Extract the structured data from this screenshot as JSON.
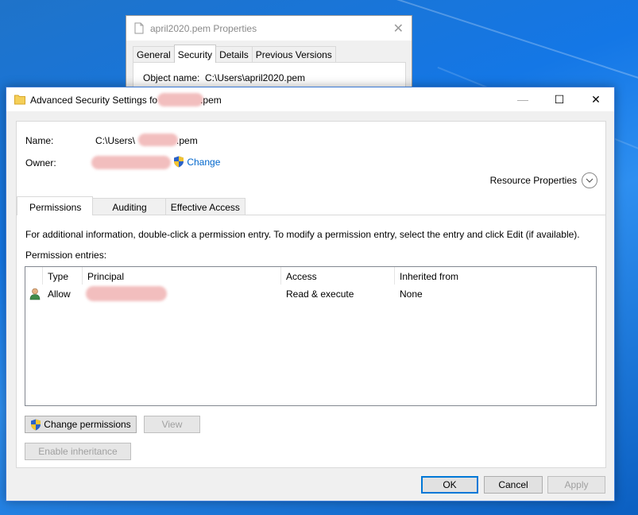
{
  "properties_dialog": {
    "title": "april2020.pem Properties",
    "tabs": [
      "General",
      "Security",
      "Details",
      "Previous Versions"
    ],
    "object_name_label": "Object name:",
    "object_name_value": "C:\\Users\\april2020.pem"
  },
  "window": {
    "title_prefix": "Advanced Security Settings fo",
    "title_suffix": ".pem",
    "minimize": "—",
    "maximize": "☐",
    "close": "✕"
  },
  "info": {
    "name_label": "Name:",
    "name_prefix": "C:\\Users\\",
    "name_suffix": ".pem",
    "owner_label": "Owner:",
    "change_link": "Change",
    "resource_properties": "Resource Properties"
  },
  "tabs": [
    "Permissions",
    "Auditing",
    "Effective Access"
  ],
  "permissions": {
    "help_text": "For additional information, double-click a permission entry. To modify a permission entry, select the entry and click Edit (if available).",
    "entries_label": "Permission entries:",
    "columns": [
      "Type",
      "Principal",
      "Access",
      "Inherited from"
    ],
    "rows": [
      {
        "type": "Allow",
        "principal": "",
        "access": "Read & execute",
        "inherited_from": "None"
      }
    ]
  },
  "buttons": {
    "change_permissions": "Change permissions",
    "view": "View",
    "enable_inheritance": "Enable inheritance",
    "ok": "OK",
    "cancel": "Cancel",
    "apply": "Apply"
  }
}
